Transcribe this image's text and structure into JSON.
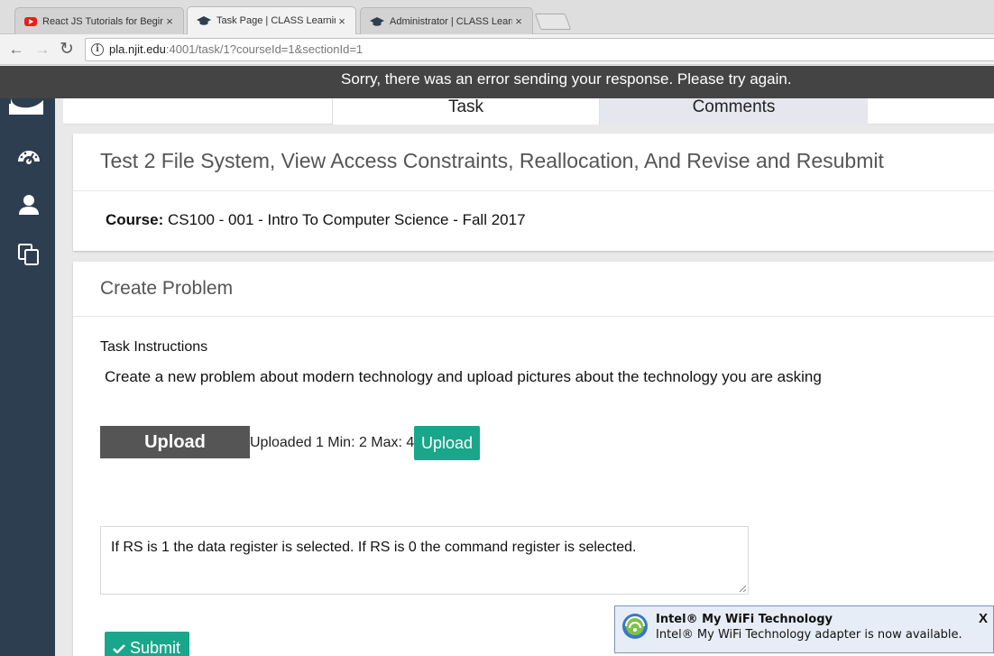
{
  "browser": {
    "tabs": [
      {
        "title": "React JS Tutorials for Begin",
        "favicon": "youtube-icon",
        "active": false
      },
      {
        "title": "Task Page | CLASS Learning",
        "favicon": "graduation-cap-icon",
        "active": true
      },
      {
        "title": "Administrator | CLASS Learn",
        "favicon": "graduation-cap-icon",
        "active": false
      }
    ],
    "tab_close": "×",
    "url_host": "pla.njit.edu",
    "url_path": ":4001/task/1?courseId=1&sectionId=1"
  },
  "error_banner": "Sorry, there was an error sending your response. Please try again.",
  "page_tabs": {
    "task": "Task",
    "comments": "Comments"
  },
  "task": {
    "title": "Test 2 File System, View Access Constraints, Reallocation, And Revise and Resubmit",
    "course_label": "Course:",
    "course_value": "CS100 - 001 - Intro To Computer Science - Fall 2017"
  },
  "problem": {
    "heading": "Create Problem",
    "instructions_label": "Task Instructions",
    "instructions_text": "Create a new problem about modern technology and upload pictures about the technology you are asking",
    "upload_primary_label": "Upload",
    "upload_status": "Uploaded 1 Min: 2 Max: 4",
    "upload_secondary_label": "Upload",
    "answer_text": "If RS  is 1 the data register is selected. If RS is 0 the command register is selected.",
    "submit_label": "Submit"
  },
  "notification": {
    "title": "Intel® My WiFi Technology",
    "message": "Intel® My WiFi Technology adapter is now available.",
    "close_label": "X"
  },
  "colors": {
    "sidebar": "#2d3e50",
    "error_bar": "#444444",
    "accent_green": "#1aa68a",
    "upload_dark": "#555555"
  }
}
